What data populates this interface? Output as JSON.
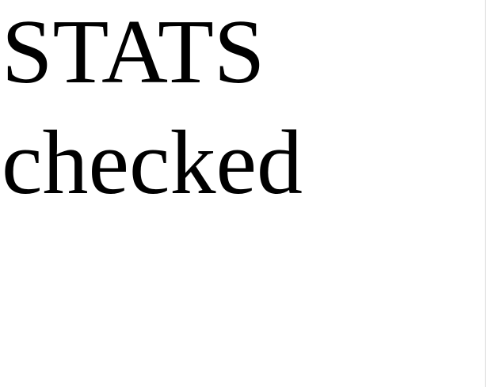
{
  "content": {
    "line_1": "STATS",
    "line_2": "checked"
  },
  "colors": {
    "background": "#ffffff",
    "text": "#000000"
  }
}
